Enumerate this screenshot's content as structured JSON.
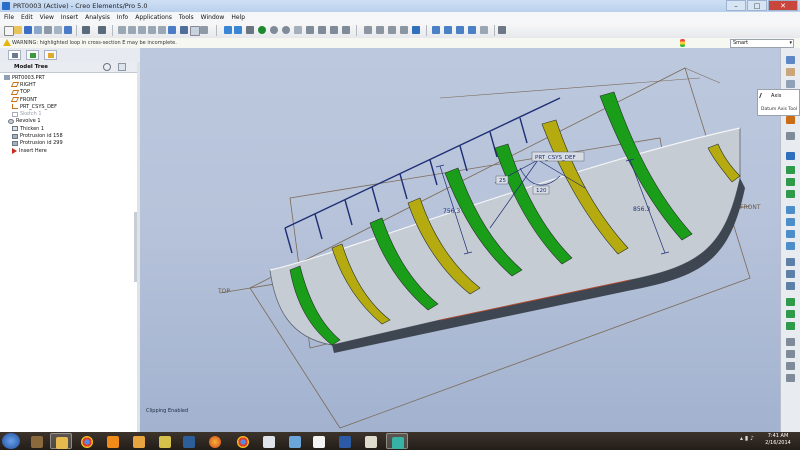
{
  "window": {
    "title": "PRT0003 (Active) - Creo Elements/Pro 5.0",
    "buttons": [
      "–",
      "□",
      "✕"
    ]
  },
  "menubar": [
    "File",
    "Edit",
    "View",
    "Insert",
    "Analysis",
    "Info",
    "Applications",
    "Tools",
    "Window",
    "Help"
  ],
  "message": {
    "text": "WARNING: highlighted loop in cross-section E may be incomplete."
  },
  "filter": {
    "value": "Smart"
  },
  "model_tree": {
    "title": "Model Tree",
    "items": [
      {
        "label": "PRT0003.PRT",
        "icon": "part-icon"
      },
      {
        "label": "RIGHT",
        "icon": "datum-plane-icon"
      },
      {
        "label": "TOP",
        "icon": "datum-plane-icon"
      },
      {
        "label": "FRONT",
        "icon": "datum-plane-icon"
      },
      {
        "label": "PRT_CSYS_DEF",
        "icon": "csys-icon"
      },
      {
        "label": "Sketch 1",
        "icon": "sketch-icon",
        "suppressed": true
      },
      {
        "label": "Revolve 1",
        "icon": "revolve-icon"
      },
      {
        "label": "Thicken 1",
        "icon": "thicken-icon"
      },
      {
        "label": "Protrusion id 158",
        "icon": "protrusion-icon"
      },
      {
        "label": "Protrusion id 299",
        "icon": "protrusion-icon"
      },
      {
        "label": "Insert Here",
        "icon": "insert-here-icon"
      }
    ]
  },
  "viewport": {
    "annotations": {
      "csys": "PRT_CSYS_DEF",
      "dim1": "756.3",
      "dim2": "856.3",
      "dim3": "120",
      "dim4": "25",
      "plane_front": "FRONT",
      "plane_top": "TOP"
    },
    "status": "Clipping Enabled"
  },
  "tooltip": {
    "title": "Axis",
    "description": "Datum Axis Tool"
  },
  "taskbar": {
    "time": "7:41 AM",
    "date": "2/16/2014"
  },
  "colors": {
    "accent": "#1a9e1a",
    "secondary": "#b5ab10",
    "surface": "#c6ccd4",
    "viewport_bg": "#b7c3da"
  }
}
